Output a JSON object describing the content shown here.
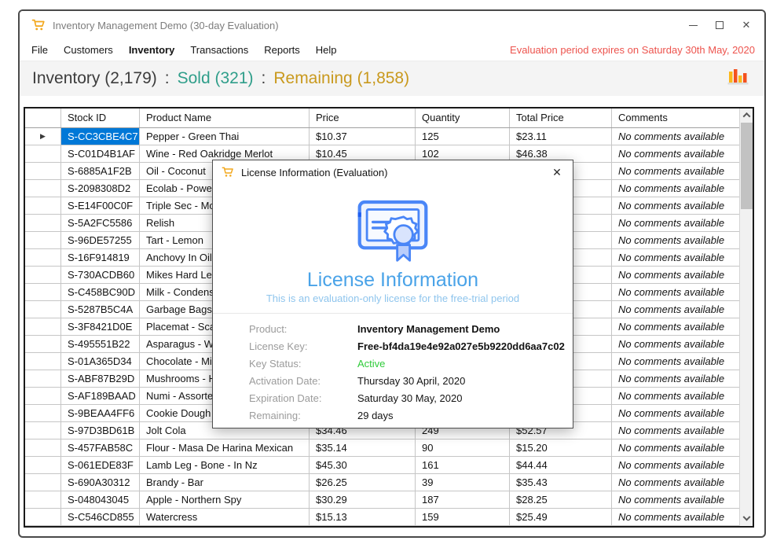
{
  "colors": {
    "selection_blue": "#0078d7",
    "evaluation_red": "#ed544e",
    "sold_teal": "#2f9e8a",
    "remaining_gold": "#c9991d",
    "license_blue": "#4aa3e8",
    "license_subtitle_blue": "#8fc5ed",
    "active_green": "#2fcb3a",
    "cart_gold": "#f2a71b",
    "certificate_blue": "#4a86f7"
  },
  "window": {
    "title": "Inventory Management Demo (30-day Evaluation)",
    "app_icon": "shopping-cart-icon",
    "controls": {
      "minimize": "minimize",
      "maximize": "maximize",
      "close": "✕"
    }
  },
  "menu": {
    "items": [
      "File",
      "Customers",
      "Inventory",
      "Transactions",
      "Reports",
      "Help"
    ],
    "active_item": "Inventory",
    "evaluation_notice": "Evaluation period expires on Saturday 30th May, 2020"
  },
  "header": {
    "inventory_label": "Inventory (2,179)",
    "separator": ":",
    "sold_label": "Sold (321)",
    "remaining_label": "Remaining (1,858)",
    "chart_icon": "bar-chart-icon"
  },
  "table": {
    "columns": [
      "Stock ID",
      "Product Name",
      "Price",
      "Quantity",
      "Total Price",
      "Comments"
    ],
    "selected_row_index": 0,
    "selector_glyph": "▶",
    "rows": [
      {
        "stock_id": "S-CC3CBE4C7",
        "product": "Pepper - Green Thai",
        "price": "$10.37",
        "quantity": "125",
        "total": "$23.11",
        "comments": "No comments available"
      },
      {
        "stock_id": "S-C01D4B1AF",
        "product": "Wine - Red Oakridge Merlot",
        "price": "$10.45",
        "quantity": "102",
        "total": "$46.38",
        "comments": "No comments available"
      },
      {
        "stock_id": "S-6885A1F2B",
        "product": "Oil - Coconut",
        "price": "",
        "quantity": "",
        "total": "",
        "comments": "No comments available"
      },
      {
        "stock_id": "S-2098308D2",
        "product": "Ecolab - Power F",
        "price": "",
        "quantity": "",
        "total": "",
        "comments": "No comments available"
      },
      {
        "stock_id": "S-E14F00C0F",
        "product": "Triple Sec - Mcgu",
        "price": "",
        "quantity": "",
        "total": "",
        "comments": "No comments available"
      },
      {
        "stock_id": "S-5A2FC5586",
        "product": "Relish",
        "price": "",
        "quantity": "",
        "total": "",
        "comments": "No comments available"
      },
      {
        "stock_id": "S-96DE57255",
        "product": "Tart - Lemon",
        "price": "",
        "quantity": "",
        "total": "",
        "comments": "No comments available"
      },
      {
        "stock_id": "S-16F914819",
        "product": "Anchovy In Oil",
        "price": "",
        "quantity": "",
        "total": "",
        "comments": "No comments available"
      },
      {
        "stock_id": "S-730ACDB60",
        "product": "Mikes Hard Lemo",
        "price": "",
        "quantity": "",
        "total": "",
        "comments": "No comments available"
      },
      {
        "stock_id": "S-C458BC90D",
        "product": "Milk - Condensed",
        "price": "",
        "quantity": "",
        "total": "",
        "comments": "No comments available"
      },
      {
        "stock_id": "S-5287B5C4A",
        "product": "Garbage Bags - C",
        "price": "",
        "quantity": "",
        "total": "",
        "comments": "No comments available"
      },
      {
        "stock_id": "S-3F8421D0E",
        "product": "Placemat - Scallo",
        "price": "",
        "quantity": "",
        "total": "",
        "comments": "No comments available"
      },
      {
        "stock_id": "S-495551B22",
        "product": "Asparagus - Whit",
        "price": "",
        "quantity": "",
        "total": "",
        "comments": "No comments available"
      },
      {
        "stock_id": "S-01A365D34",
        "product": "Chocolate - Milk",
        "price": "",
        "quantity": "",
        "total": "",
        "comments": "No comments available"
      },
      {
        "stock_id": "S-ABF87B29D",
        "product": "Mushrooms - Ho",
        "price": "",
        "quantity": "",
        "total": "",
        "comments": "No comments available"
      },
      {
        "stock_id": "S-AF189BAAD",
        "product": "Numi - Assorted",
        "price": "",
        "quantity": "",
        "total": "",
        "comments": "No comments available"
      },
      {
        "stock_id": "S-9BEAA4FF6",
        "product": "Cookie Dough - ",
        "price": "",
        "quantity": "",
        "total": "",
        "comments": "No comments available"
      },
      {
        "stock_id": "S-97D3BD61B",
        "product": "Jolt Cola",
        "price": "$34.46",
        "quantity": "249",
        "total": "$52.57",
        "comments": "No comments available"
      },
      {
        "stock_id": "S-457FAB58C",
        "product": "Flour - Masa De Harina Mexican",
        "price": "$35.14",
        "quantity": "90",
        "total": "$15.20",
        "comments": "No comments available"
      },
      {
        "stock_id": "S-061EDE83F",
        "product": "Lamb Leg - Bone - In Nz",
        "price": "$45.30",
        "quantity": "161",
        "total": "$44.44",
        "comments": "No comments available"
      },
      {
        "stock_id": "S-690A30312",
        "product": "Brandy - Bar",
        "price": "$26.25",
        "quantity": "39",
        "total": "$35.43",
        "comments": "No comments available"
      },
      {
        "stock_id": "S-048043045",
        "product": "Apple - Northern Spy",
        "price": "$30.29",
        "quantity": "187",
        "total": "$28.25",
        "comments": "No comments available"
      },
      {
        "stock_id": "S-C546CD855",
        "product": "Watercress",
        "price": "$15.13",
        "quantity": "159",
        "total": "$25.49",
        "comments": "No comments available"
      }
    ]
  },
  "dialog": {
    "titlebar": "License Information (Evaluation)",
    "app_icon": "shopping-cart-icon",
    "close_glyph": "✕",
    "icon": "certificate-icon",
    "heading": "License Information",
    "subheading": "This is an evaluation-only license for the free-trial period",
    "fields": [
      {
        "label": "Product:",
        "value": "Inventory Management Demo",
        "style": "bold"
      },
      {
        "label": "License Key:",
        "value": "Free-bf4da19e4e92a027e5b9220dd6aa7c02",
        "style": "bold"
      },
      {
        "label": "Key Status:",
        "value": "Active",
        "style": "active"
      },
      {
        "label": "Activation Date:",
        "value": "Thursday 30 April, 2020",
        "style": "normal"
      },
      {
        "label": "Expiration Date:",
        "value": "Saturday 30 May, 2020",
        "style": "normal"
      },
      {
        "label": "Remaining:",
        "value": "29 days",
        "style": "normal"
      }
    ]
  }
}
